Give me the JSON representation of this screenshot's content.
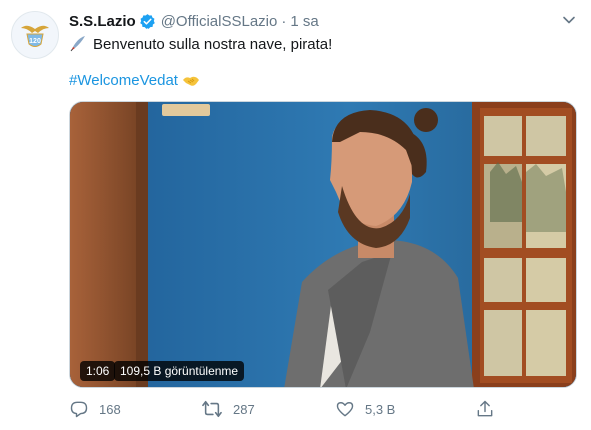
{
  "tweet": {
    "author_name": "S.S.Lazio",
    "handle": "@OfficialSSLazio",
    "separator": "·",
    "time": "1 sa",
    "text": "Benvenuto sulla nostra nave, pirata!",
    "hashtag": "#WelcomeVedat"
  },
  "video": {
    "duration": "1:06",
    "views": "109,5 B görüntülenme"
  },
  "actions": {
    "reply_count": "168",
    "retweet_count": "287",
    "like_count": "5,3 B"
  },
  "colors": {
    "link": "#1b95e0",
    "secondary_text": "#657786",
    "verified": "#1da1f2"
  },
  "icons": [
    "lazio-eagle-logo",
    "verified-icon",
    "chevron-down-icon",
    "quill-pen-emoji",
    "handshake-emoji",
    "reply-icon",
    "retweet-icon",
    "like-icon",
    "share-icon"
  ]
}
